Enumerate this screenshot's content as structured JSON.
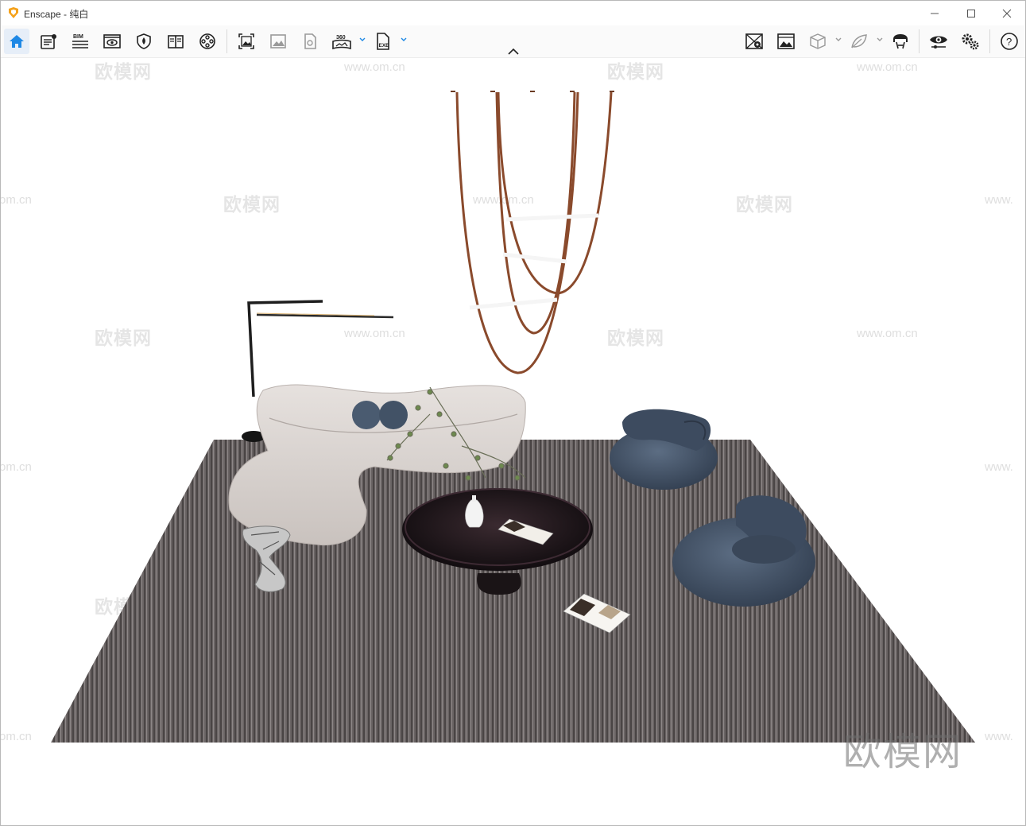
{
  "window": {
    "app_name": "Enscape",
    "title_separator": " - ",
    "file_name": "纯白"
  },
  "window_controls": [
    "minimize-icon",
    "maximize-icon",
    "close-icon"
  ],
  "toolbar": {
    "left": [
      {
        "name": "home-icon",
        "active": true
      },
      {
        "name": "settings-document-icon"
      },
      {
        "name": "bim-info-icon",
        "label": "BIM"
      },
      {
        "name": "views-icon"
      },
      {
        "name": "material-shield-icon"
      },
      {
        "name": "book-icon"
      },
      {
        "name": "video-reel-icon"
      },
      {
        "name": "screenshot-icon"
      },
      {
        "name": "gallery-image-icon"
      },
      {
        "name": "document-export-icon"
      },
      {
        "name": "panorama-360-icon",
        "label": "360",
        "dropdown": true
      },
      {
        "name": "exe-export-icon",
        "label": "EXE",
        "dropdown": true
      }
    ],
    "right": [
      {
        "name": "map-pin-icon"
      },
      {
        "name": "atmosphere-image-icon"
      },
      {
        "name": "cube-icon",
        "dropdown": true
      },
      {
        "name": "leaf-icon",
        "dropdown": true
      },
      {
        "name": "vr-headset-icon"
      },
      {
        "name": "visual-settings-eye-icon"
      },
      {
        "name": "general-settings-gears-icon"
      },
      {
        "name": "help-icon",
        "label": "?"
      }
    ],
    "collapse_icon": "chevron-up-icon"
  },
  "viewport": {
    "watermark_text": "欧模网",
    "watermark_url": "www.om.cn",
    "watermark_url_partial": "om.cn",
    "watermark_url_cut": "www.",
    "corner_logo": "欧模网",
    "scene_objects": [
      "pendant-lamp",
      "floor-lamp",
      "curved-sofa",
      "coffee-table",
      "vase",
      "magazine",
      "armchair",
      "armchair",
      "area-rug",
      "side-table"
    ]
  },
  "colors": {
    "accent": "#1e88e5",
    "rug": "#6e6868",
    "sofa": "#d9d3cf",
    "chair": "#4a5a6e",
    "lamp_strap": "#8a4a2c"
  }
}
